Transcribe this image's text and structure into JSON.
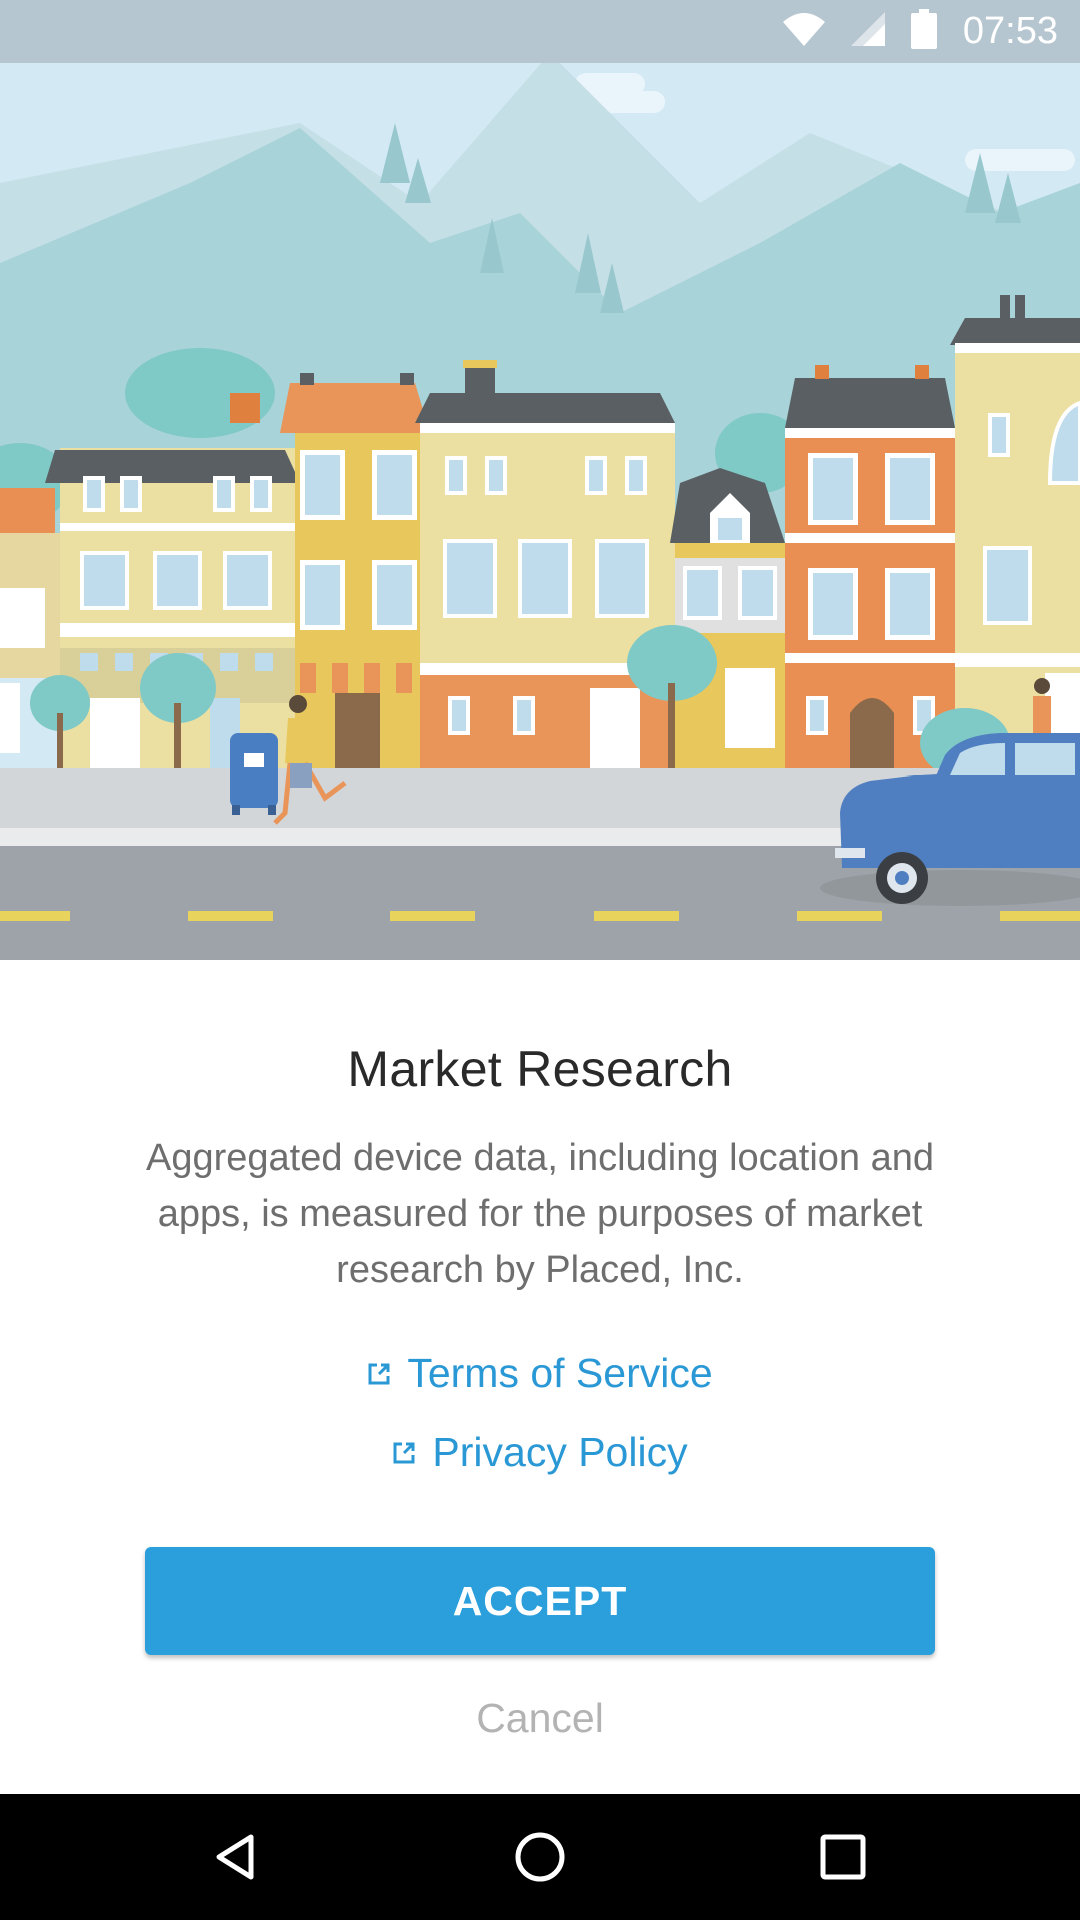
{
  "status_bar": {
    "time": "07:53",
    "icons": [
      "wifi-icon",
      "cell-signal-icon",
      "battery-icon"
    ]
  },
  "hero": {
    "illustration": "city-street-illustration"
  },
  "dialog": {
    "title": "Market Research",
    "description": "Aggregated device data, including location and apps, is measured for the purposes of market research by Placed, Inc.",
    "links": {
      "terms_label": "Terms of Service",
      "privacy_label": "Privacy Policy",
      "icon": "external-link-icon"
    },
    "accept_label": "ACCEPT",
    "cancel_label": "Cancel"
  },
  "nav_bar": {
    "buttons": [
      "back-icon",
      "home-icon",
      "recents-icon"
    ]
  },
  "colors": {
    "status_bar": "#b6c6d0",
    "accent": "#2a9fdb",
    "link": "#2b98d6",
    "title": "#2a2a2a",
    "body_text": "#6e6e6e",
    "cancel_text": "#b3b3b3",
    "nav_bar": "#000000"
  }
}
